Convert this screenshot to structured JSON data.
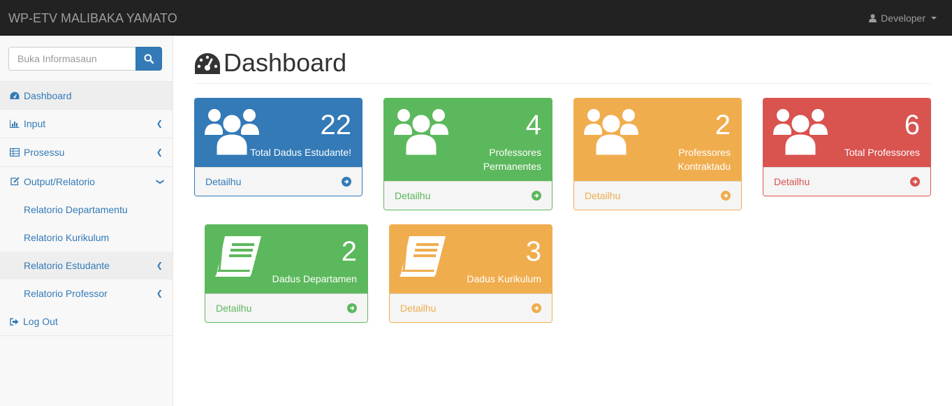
{
  "app": {
    "title": "WP-ETV MALIBAKA YAMATO",
    "user": "Developer"
  },
  "search": {
    "placeholder": "Buka Informasaun"
  },
  "sidebar": {
    "items": [
      {
        "label": "Dashboard",
        "icon": "dashboard-icon"
      },
      {
        "label": "Input",
        "icon": "bar-chart-icon"
      },
      {
        "label": "Prosessu",
        "icon": "table-icon"
      },
      {
        "label": "Output/Relatorio",
        "icon": "edit-icon"
      },
      {
        "label": "Relatorio Departamentu"
      },
      {
        "label": "Relatorio Kurikulum"
      },
      {
        "label": "Relatorio Estudante"
      },
      {
        "label": "Relatorio Professor"
      },
      {
        "label": "Log Out",
        "icon": "sign-out-icon"
      }
    ]
  },
  "page": {
    "title": "Dashboard"
  },
  "cards": [
    {
      "value": "22",
      "label": "Total Dadus Estudante!",
      "link": "Detailhu",
      "color": "#337ab7"
    },
    {
      "value": "4",
      "label_line1": "Professores",
      "label_line2": "Permanentes",
      "link": "Detailhu",
      "color": "#5cb85c"
    },
    {
      "value": "2",
      "label_line1": "Professores",
      "label_line2": "Kontraktadu",
      "link": "Detailhu",
      "color": "#f0ad4e"
    },
    {
      "value": "6",
      "label": "Total Professores",
      "link": "Detailhu",
      "color": "#d9534f"
    },
    {
      "value": "2",
      "label": "Dadus Departamen",
      "link": "Detailhu",
      "color": "#5cb85c"
    },
    {
      "value": "3",
      "label": "Dadus Kurikulum",
      "link": "Detailhu",
      "color": "#f0ad4e"
    }
  ]
}
